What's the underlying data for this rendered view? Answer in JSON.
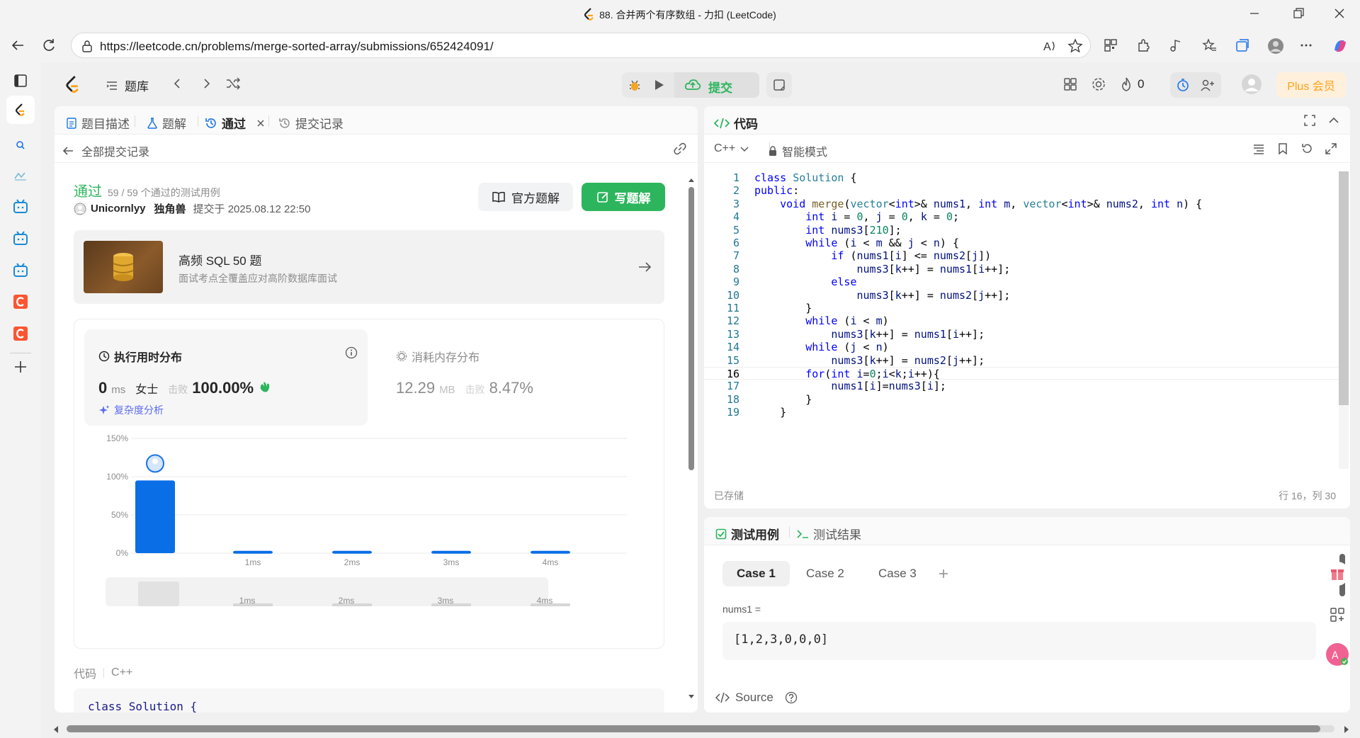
{
  "window": {
    "title": "88. 合并两个有序数组 - 力扣 (LeetCode)"
  },
  "browser": {
    "url": "https://leetcode.cn/problems/merge-sorted-array/submissions/652424091/"
  },
  "topnav": {
    "problem_list_label": "题库",
    "submit_label": "提交",
    "streak_count": "0",
    "plus_label": "Plus 会员"
  },
  "left_tabs": [
    {
      "label": "题目描述",
      "icon": "doc-icon"
    },
    {
      "label": "题解",
      "icon": "flask-icon"
    },
    {
      "label": "通过",
      "icon": "history-icon"
    },
    {
      "label": "提交记录",
      "icon": "history-icon"
    }
  ],
  "back_label": "全部提交记录",
  "submission": {
    "status": "通过",
    "cases_text": "59 / 59 个通过的测试用例",
    "user": "Unicornlyy",
    "user_title": "独角兽",
    "submitted_at": "提交于 2025.08.12 22:50",
    "official_solution_label": "官方题解",
    "write_solution_label": "写题解"
  },
  "promo": {
    "title": "高频 SQL 50 题",
    "subtitle": "面试考点全覆盖应对高阶数据库面试"
  },
  "runtime": {
    "title": "执行用时分布",
    "value": "0",
    "unit": "ms",
    "user_label": "女士",
    "beats_label": "击败",
    "beats_value": "100.00%",
    "complexity_label": "复杂度分析"
  },
  "memory": {
    "title": "消耗内存分布",
    "value": "12.29",
    "unit": "MB",
    "beats_label": "击败",
    "beats_value": "8.47%"
  },
  "chart_data": {
    "type": "bar",
    "categories": [
      "0ms",
      "1ms",
      "2ms",
      "3ms",
      "4ms"
    ],
    "x_tick_labels": [
      "",
      "1ms",
      "2ms",
      "3ms",
      "4ms"
    ],
    "values": [
      95,
      3,
      3,
      3,
      3
    ],
    "ylim": [
      0,
      150
    ],
    "y_ticks": [
      "150%",
      "100%",
      "50%",
      "0%"
    ],
    "y_tick_values": [
      150,
      100,
      50,
      0
    ],
    "bar_color": "#0a6ee6",
    "grid": true,
    "mini_labels": [
      "1ms",
      "2ms",
      "3ms",
      "4ms"
    ]
  },
  "code_section": {
    "label": "代码",
    "lang": "C++",
    "preview_first_line": "class Solution {"
  },
  "editor": {
    "title": "代码",
    "language": "C++",
    "mode": "智能模式",
    "saved": "已存储",
    "cursor": "行 16，列 30",
    "lines": [
      "class Solution {",
      "public:",
      "    void merge(vector<int>& nums1, int m, vector<int>& nums2, int n) {",
      "        int i = 0, j = 0, k = 0;",
      "        int nums3[210];",
      "        while (i < m && j < n) {",
      "            if (nums1[i] <= nums2[j])",
      "                nums3[k++] = nums1[i++];",
      "            else",
      "                nums3[k++] = nums2[j++];",
      "        }",
      "        while (i < m)",
      "            nums3[k++] = nums1[i++];",
      "        while (j < n)",
      "            nums3[k++] = nums2[j++];",
      "        for(int i=0;i<k;i++){",
      "            nums1[i]=nums3[i];",
      "        }",
      "    }"
    ],
    "current_line": 16
  },
  "testpanel": {
    "tab_cases": "测试用例",
    "tab_result": "测试结果",
    "cases": [
      "Case 1",
      "Case 2",
      "Case 3"
    ],
    "param_label": "nums1 =",
    "param_value": "[1,2,3,0,0,0]",
    "source_label": "Source"
  },
  "colors": {
    "accent_green": "#2db55d",
    "accent_blue": "#0a6ee6",
    "plus_orange": "#ffa116"
  }
}
